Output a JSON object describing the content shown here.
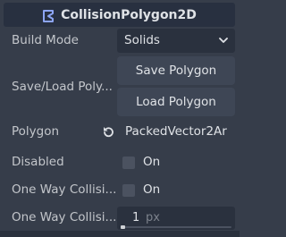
{
  "header": {
    "title": "CollisionPolygon2D",
    "icon": "collision-polygon-icon",
    "icon_color": "#8da5f3"
  },
  "properties": {
    "build_mode": {
      "label": "Build Mode",
      "value": "Solids"
    },
    "save_load": {
      "label": "Save/Load Poly...",
      "save_button": "Save Polygon",
      "load_button": "Load Polygon"
    },
    "polygon": {
      "label": "Polygon",
      "value": "PackedVector2Ar"
    },
    "disabled": {
      "label": "Disabled",
      "checkbox_label": "On",
      "checked": false
    },
    "one_way": {
      "label": "One Way Collisi...",
      "checkbox_label": "On",
      "checked": false
    },
    "one_way_margin": {
      "label": "One Way Collisi...",
      "value": "1",
      "unit": "px"
    }
  }
}
